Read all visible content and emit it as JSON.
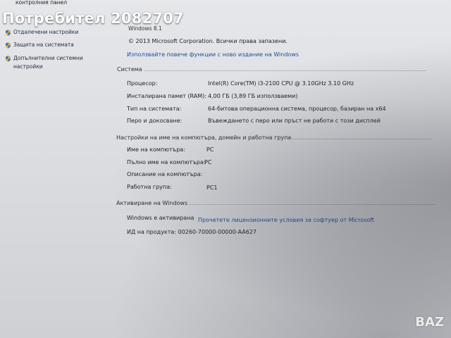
{
  "watermark": {
    "title": "Потребител 2082707",
    "brand": "BAZ"
  },
  "left_pane": {
    "top_label": "контролния панел",
    "links": [
      {
        "label": "Отдалечени настройки",
        "icon": "shield-icon"
      },
      {
        "label": "Защита на системата",
        "icon": "shield-icon"
      },
      {
        "label": "Допълнителни системни",
        "icon": "shield-icon"
      }
    ],
    "link_cont": "настройки"
  },
  "edition": {
    "name": "Windows 8.1",
    "copyright": "© 2013 Microsoft Corporation. Всички права запазени.",
    "upgrade_link": "Използвайте повече функции с ново издание на Windows"
  },
  "system": {
    "heading": "Система",
    "rows": [
      {
        "label": "Процесор:",
        "value": "Intel(R) Core(TM) i3-2100 CPU @ 3.10GHz   3.10 GHz"
      },
      {
        "label": "Инсталирана памет (RAM):",
        "value": "4,00 ГБ (3,89 ГБ използваеми)"
      },
      {
        "label": "Тип на системата:",
        "value": "64-битова операционна система, процесор, базиран на x64"
      },
      {
        "label": "Перо и докосване:",
        "value": "Въвеждането с перо или пръст не работи с този дисплей"
      }
    ]
  },
  "computer_name": {
    "heading": "Настройки на име на компютъра, домейн и работна група",
    "rows": [
      {
        "label": "Име на компютъра:",
        "value": "PC"
      },
      {
        "label": "Пълно име на компютъра:",
        "value": "PC"
      },
      {
        "label": "Описание на компютъра:",
        "value": ""
      },
      {
        "label": "Работна група:",
        "value": "PC1"
      }
    ]
  },
  "activation": {
    "heading": "Активиране на Windows",
    "status": "Windows е активирана",
    "license_link": "Прочетете лицензионните условия за софтуер от Microsoft",
    "product_id": "ИД на продукта: 00260-70000-00000-AA627"
  },
  "colors": {
    "link": "#1d4f9a",
    "text": "#1f1f24",
    "background": "#dcdde1"
  }
}
